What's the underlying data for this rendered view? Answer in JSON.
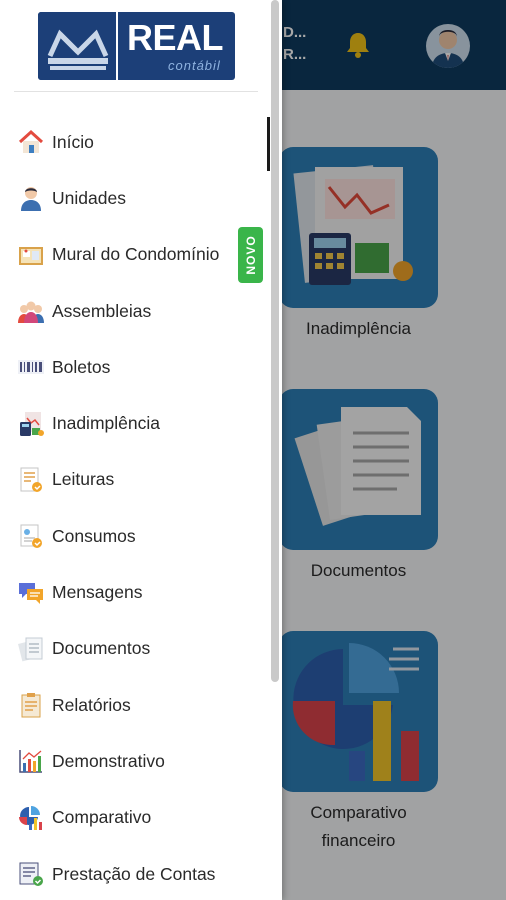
{
  "background": {
    "header_truncated_lines": [
      "D...",
      "R..."
    ],
    "tiles": [
      {
        "label_lines": [
          "Inadimplência"
        ],
        "icon": "delinquency-illustration"
      },
      {
        "label_lines": [
          "Documentos"
        ],
        "icon": "documents-illustration"
      },
      {
        "label_lines": [
          "Comparativo",
          "financeiro"
        ],
        "icon": "financial-comparison-illustration"
      }
    ]
  },
  "drawer": {
    "logo": {
      "text": "REAL",
      "subtext": "contábil"
    },
    "badge_label": "NOVO",
    "items": [
      {
        "label": "Início",
        "icon": "house-icon"
      },
      {
        "label": "Unidades",
        "icon": "person-icon"
      },
      {
        "label": "Mural do Condomínio",
        "icon": "bulletin-board-icon"
      },
      {
        "label": "Assembleias",
        "icon": "people-group-icon"
      },
      {
        "label": "Boletos",
        "icon": "barcode-icon"
      },
      {
        "label": "Inadimplência",
        "icon": "calculator-icon"
      },
      {
        "label": "Leituras",
        "icon": "meter-reading-icon"
      },
      {
        "label": "Consumos",
        "icon": "consumption-icon"
      },
      {
        "label": "Mensagens",
        "icon": "chat-bubbles-icon"
      },
      {
        "label": "Documentos",
        "icon": "documents-icon"
      },
      {
        "label": "Relatórios",
        "icon": "clipboard-report-icon"
      },
      {
        "label": "Demonstrativo",
        "icon": "bar-chart-icon"
      },
      {
        "label": "Comparativo",
        "icon": "comparison-chart-icon"
      },
      {
        "label": "Prestação de Contas",
        "icon": "accountability-icon"
      }
    ]
  },
  "colors": {
    "header": "#0f3a5e",
    "tile": "#2d7fb6",
    "logo": "#1c3f78",
    "badge": "#3ab54a"
  }
}
